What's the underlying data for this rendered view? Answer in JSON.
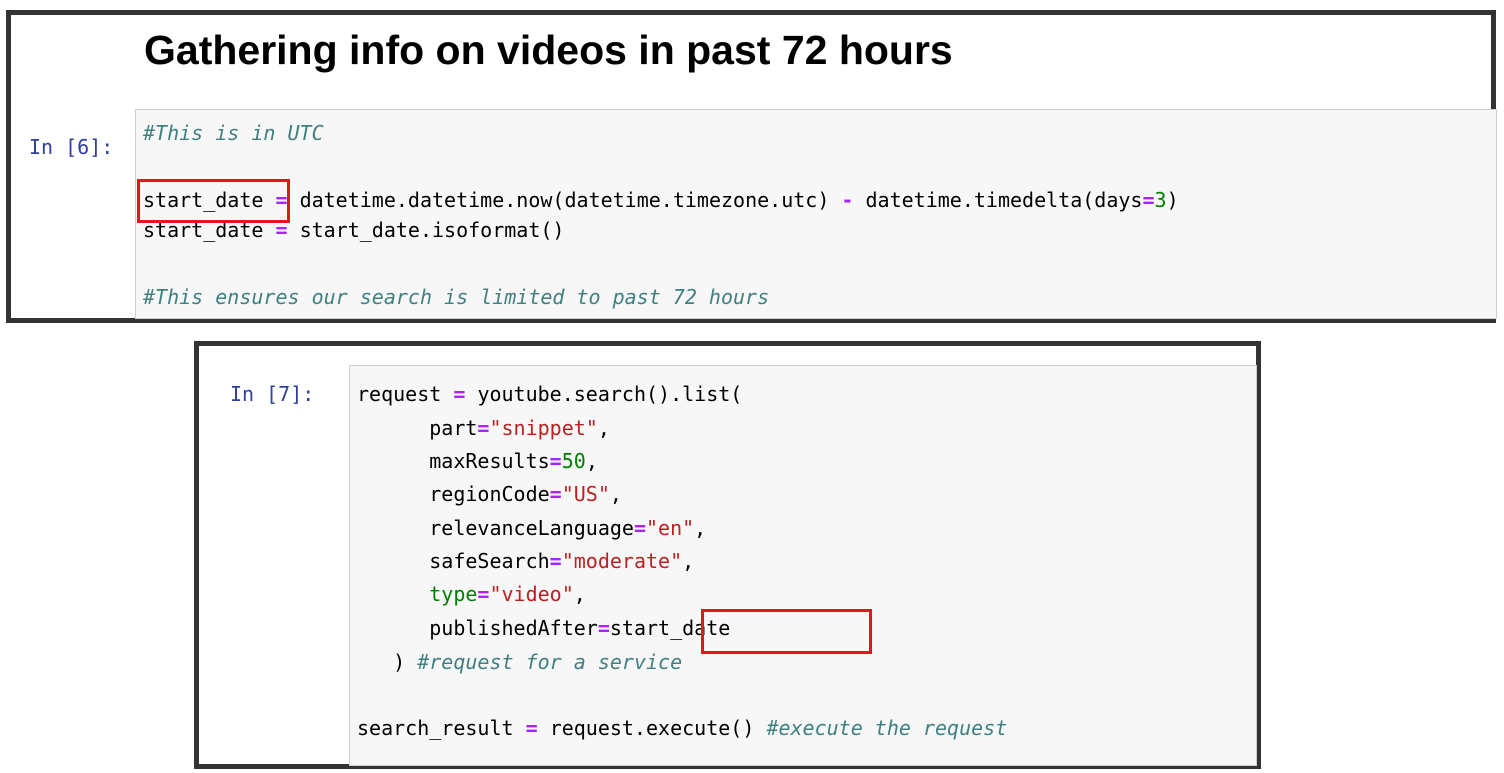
{
  "heading": "Gathering info on videos in past 72 hours",
  "cell6": {
    "prompt": "In [6]:",
    "line1": {
      "comment": "#This is in UTC"
    },
    "line2": {
      "var": "start_date",
      "op_eq": "=",
      "expr": "datetime.datetime.now(datetime.timezone.utc)",
      "op_minus": "-",
      "call": "datetime.timedelta(days",
      "op_kw": "=",
      "num": "3",
      "close": ")"
    },
    "line3": {
      "var": "start_date",
      "op_eq": "=",
      "expr": "start_date.isoformat()"
    },
    "line4": {
      "comment": "#This ensures our search is limited to past 72 hours"
    }
  },
  "cell7": {
    "prompt": "In [7]:",
    "line1": {
      "var": "request",
      "op_eq": "=",
      "expr": "youtube.search().list("
    },
    "line2": {
      "kw": "part",
      "op": "=",
      "val": "\"snippet\"",
      "tail": ","
    },
    "line3": {
      "kw": "maxResults",
      "op": "=",
      "val": "50",
      "tail": ","
    },
    "line4": {
      "kw": "regionCode",
      "op": "=",
      "val": "\"US\"",
      "tail": ","
    },
    "line5": {
      "kw": "relevanceLanguage",
      "op": "=",
      "val": "\"en\"",
      "tail": ","
    },
    "line6": {
      "kw": "safeSearch",
      "op": "=",
      "val": "\"moderate\"",
      "tail": ","
    },
    "line7": {
      "kw": "type",
      "op": "=",
      "val": "\"video\"",
      "tail": ","
    },
    "line8": {
      "kw": "publishedAfter",
      "op": "=",
      "val": "start_date"
    },
    "line9": {
      "paren": ")",
      "comment": "#request for a service"
    },
    "line10": {
      "var": "search_result",
      "op_eq": "=",
      "expr": "request.execute()",
      "comment": "#execute the request"
    }
  },
  "colors": {
    "comment": "#408080",
    "operator": "#aa22ff",
    "string": "#ba2121",
    "number": "#008000",
    "prompt": "#303f9f",
    "highlight": "#e8141c",
    "panel_border": "#333333"
  }
}
